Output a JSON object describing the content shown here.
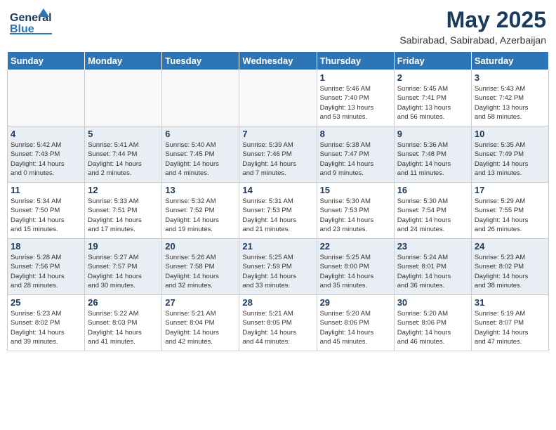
{
  "header": {
    "logo_line1": "General",
    "logo_line2": "Blue",
    "title": "May 2025",
    "subtitle": "Sabirabad, Sabirabad, Azerbaijan"
  },
  "weekdays": [
    "Sunday",
    "Monday",
    "Tuesday",
    "Wednesday",
    "Thursday",
    "Friday",
    "Saturday"
  ],
  "weeks": [
    [
      {
        "day": "",
        "info": ""
      },
      {
        "day": "",
        "info": ""
      },
      {
        "day": "",
        "info": ""
      },
      {
        "day": "",
        "info": ""
      },
      {
        "day": "1",
        "info": "Sunrise: 5:46 AM\nSunset: 7:40 PM\nDaylight: 13 hours\nand 53 minutes."
      },
      {
        "day": "2",
        "info": "Sunrise: 5:45 AM\nSunset: 7:41 PM\nDaylight: 13 hours\nand 56 minutes."
      },
      {
        "day": "3",
        "info": "Sunrise: 5:43 AM\nSunset: 7:42 PM\nDaylight: 13 hours\nand 58 minutes."
      }
    ],
    [
      {
        "day": "4",
        "info": "Sunrise: 5:42 AM\nSunset: 7:43 PM\nDaylight: 14 hours\nand 0 minutes."
      },
      {
        "day": "5",
        "info": "Sunrise: 5:41 AM\nSunset: 7:44 PM\nDaylight: 14 hours\nand 2 minutes."
      },
      {
        "day": "6",
        "info": "Sunrise: 5:40 AM\nSunset: 7:45 PM\nDaylight: 14 hours\nand 4 minutes."
      },
      {
        "day": "7",
        "info": "Sunrise: 5:39 AM\nSunset: 7:46 PM\nDaylight: 14 hours\nand 7 minutes."
      },
      {
        "day": "8",
        "info": "Sunrise: 5:38 AM\nSunset: 7:47 PM\nDaylight: 14 hours\nand 9 minutes."
      },
      {
        "day": "9",
        "info": "Sunrise: 5:36 AM\nSunset: 7:48 PM\nDaylight: 14 hours\nand 11 minutes."
      },
      {
        "day": "10",
        "info": "Sunrise: 5:35 AM\nSunset: 7:49 PM\nDaylight: 14 hours\nand 13 minutes."
      }
    ],
    [
      {
        "day": "11",
        "info": "Sunrise: 5:34 AM\nSunset: 7:50 PM\nDaylight: 14 hours\nand 15 minutes."
      },
      {
        "day": "12",
        "info": "Sunrise: 5:33 AM\nSunset: 7:51 PM\nDaylight: 14 hours\nand 17 minutes."
      },
      {
        "day": "13",
        "info": "Sunrise: 5:32 AM\nSunset: 7:52 PM\nDaylight: 14 hours\nand 19 minutes."
      },
      {
        "day": "14",
        "info": "Sunrise: 5:31 AM\nSunset: 7:53 PM\nDaylight: 14 hours\nand 21 minutes."
      },
      {
        "day": "15",
        "info": "Sunrise: 5:30 AM\nSunset: 7:53 PM\nDaylight: 14 hours\nand 23 minutes."
      },
      {
        "day": "16",
        "info": "Sunrise: 5:30 AM\nSunset: 7:54 PM\nDaylight: 14 hours\nand 24 minutes."
      },
      {
        "day": "17",
        "info": "Sunrise: 5:29 AM\nSunset: 7:55 PM\nDaylight: 14 hours\nand 26 minutes."
      }
    ],
    [
      {
        "day": "18",
        "info": "Sunrise: 5:28 AM\nSunset: 7:56 PM\nDaylight: 14 hours\nand 28 minutes."
      },
      {
        "day": "19",
        "info": "Sunrise: 5:27 AM\nSunset: 7:57 PM\nDaylight: 14 hours\nand 30 minutes."
      },
      {
        "day": "20",
        "info": "Sunrise: 5:26 AM\nSunset: 7:58 PM\nDaylight: 14 hours\nand 32 minutes."
      },
      {
        "day": "21",
        "info": "Sunrise: 5:25 AM\nSunset: 7:59 PM\nDaylight: 14 hours\nand 33 minutes."
      },
      {
        "day": "22",
        "info": "Sunrise: 5:25 AM\nSunset: 8:00 PM\nDaylight: 14 hours\nand 35 minutes."
      },
      {
        "day": "23",
        "info": "Sunrise: 5:24 AM\nSunset: 8:01 PM\nDaylight: 14 hours\nand 36 minutes."
      },
      {
        "day": "24",
        "info": "Sunrise: 5:23 AM\nSunset: 8:02 PM\nDaylight: 14 hours\nand 38 minutes."
      }
    ],
    [
      {
        "day": "25",
        "info": "Sunrise: 5:23 AM\nSunset: 8:02 PM\nDaylight: 14 hours\nand 39 minutes."
      },
      {
        "day": "26",
        "info": "Sunrise: 5:22 AM\nSunset: 8:03 PM\nDaylight: 14 hours\nand 41 minutes."
      },
      {
        "day": "27",
        "info": "Sunrise: 5:21 AM\nSunset: 8:04 PM\nDaylight: 14 hours\nand 42 minutes."
      },
      {
        "day": "28",
        "info": "Sunrise: 5:21 AM\nSunset: 8:05 PM\nDaylight: 14 hours\nand 44 minutes."
      },
      {
        "day": "29",
        "info": "Sunrise: 5:20 AM\nSunset: 8:06 PM\nDaylight: 14 hours\nand 45 minutes."
      },
      {
        "day": "30",
        "info": "Sunrise: 5:20 AM\nSunset: 8:06 PM\nDaylight: 14 hours\nand 46 minutes."
      },
      {
        "day": "31",
        "info": "Sunrise: 5:19 AM\nSunset: 8:07 PM\nDaylight: 14 hours\nand 47 minutes."
      }
    ]
  ]
}
